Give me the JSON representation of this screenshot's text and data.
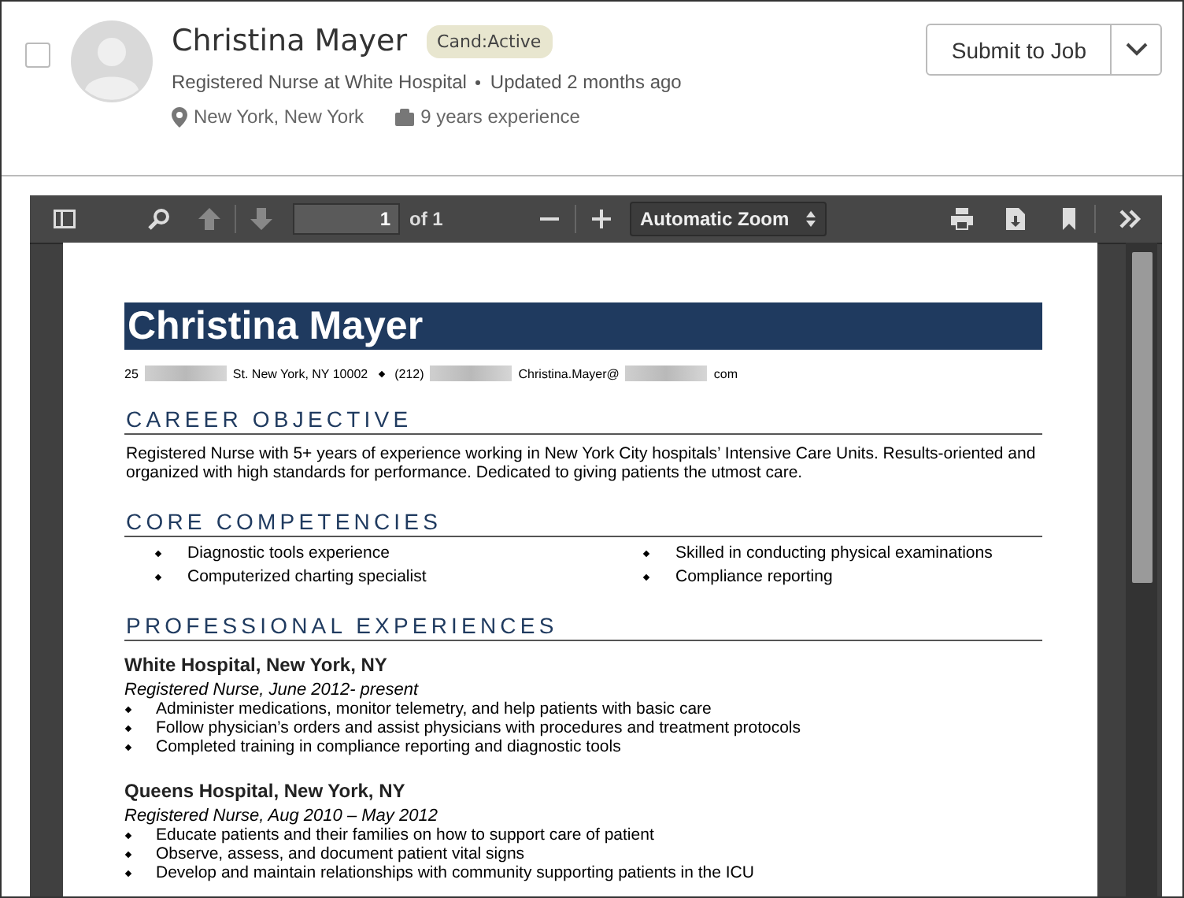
{
  "candidate": {
    "checked": false,
    "name": "Christina Mayer",
    "status": "Cand:Active",
    "headline": "Registered Nurse at White Hospital",
    "updated": "Updated 2 months ago",
    "location": "New York, New York",
    "experience": "9 years experience"
  },
  "actions": {
    "submit": "Submit to Job"
  },
  "viewer": {
    "page": "1",
    "page_count": "of 1",
    "zoom": "Automatic Zoom"
  },
  "resume": {
    "name": "Christina Mayer",
    "contact": [
      {
        "kind": "text",
        "text": "25"
      },
      {
        "kind": "redacted"
      },
      {
        "kind": "text",
        "text": "St. New York, NY 10002"
      },
      {
        "kind": "bullet"
      },
      {
        "kind": "text",
        "text": "(212)"
      },
      {
        "kind": "redacted"
      },
      {
        "kind": "text",
        "text": "Christina.Mayer@"
      },
      {
        "kind": "redacted"
      },
      {
        "kind": "text",
        "text": "com"
      }
    ],
    "sections": [
      {
        "kind": "paragraph",
        "heading": "CAREER OBJECTIVE",
        "text": "Registered Nurse with 5+ years of experience working in New York City hospitals’ Intensive Care Units. Results-oriented and organized with high standards for performance. Dedicated to giving patients the utmost care."
      },
      {
        "kind": "columns",
        "heading": "CORE COMPETENCIES",
        "items": [
          "Diagnostic tools experience",
          "Skilled in conducting physical examinations",
          "Computerized charting specialist",
          "Compliance reporting"
        ]
      },
      {
        "kind": "jobs",
        "heading": "PROFESSIONAL EXPERIENCES",
        "jobs": [
          {
            "employer": "White Hospital, New York, NY",
            "role": "Registered Nurse, June 2012- present",
            "duties": [
              "Administer medications, monitor telemetry, and help patients with basic care",
              "Follow physician’s orders and assist physicians with procedures and treatment protocols",
              "Completed training in compliance reporting and diagnostic tools"
            ]
          },
          {
            "employer": "Queens Hospital, New York, NY",
            "role": "Registered Nurse, Aug 2010 – May 2012",
            "duties": [
              "Educate patients and their families on how to support care of patient",
              "Observe, assess, and document patient vital signs",
              "Develop and maintain relationships with community supporting patients in the ICU"
            ]
          }
        ]
      }
    ]
  }
}
